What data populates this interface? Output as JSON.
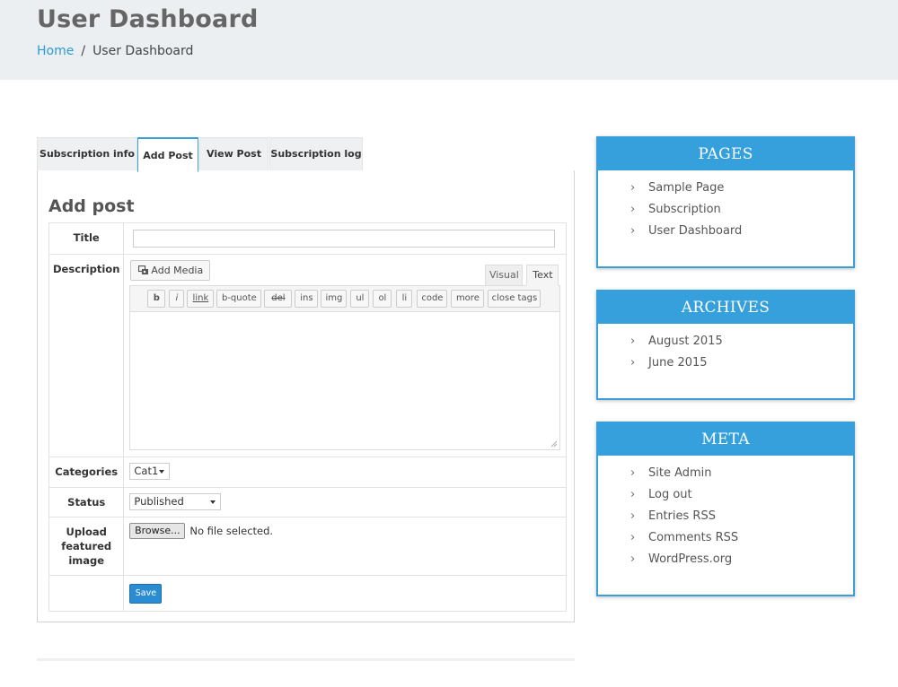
{
  "header": {
    "title": "User Dashboard",
    "breadcrumb": {
      "home": "Home",
      "separator": "/",
      "current": "User Dashboard"
    }
  },
  "tabs": [
    {
      "label": "Subscription info",
      "active": false
    },
    {
      "label": "Add Post",
      "active": true
    },
    {
      "label": "View Post",
      "active": false
    },
    {
      "label": "Subscription log",
      "active": false
    }
  ],
  "form": {
    "heading": "Add post",
    "title_label": "Title",
    "title_value": "",
    "description_label": "Description",
    "add_media": "Add Media",
    "editor_tabs": {
      "visual": "Visual",
      "text": "Text"
    },
    "quicktags": [
      "b",
      "i",
      "link",
      "b-quote",
      "del",
      "ins",
      "img",
      "ul",
      "ol",
      "li",
      "code",
      "more",
      "close tags"
    ],
    "categories_label": "Categories",
    "categories_value": "Cat1",
    "status_label": "Status",
    "status_value": "Published",
    "upload_label": "Upload featured image",
    "browse_label": "Browse...",
    "no_file": "No file selected.",
    "save_label": "Save"
  },
  "sidebar": {
    "pages": {
      "title": "PAGES",
      "items": [
        "Sample Page",
        "Subscription",
        "User Dashboard"
      ]
    },
    "archives": {
      "title": "ARCHIVES",
      "items": [
        "August 2015",
        "June 2015"
      ]
    },
    "meta": {
      "title": "META",
      "items": [
        "Site Admin",
        "Log out",
        "Entries RSS",
        "Comments RSS",
        "WordPress.org"
      ]
    }
  },
  "colors": {
    "accent": "#35a0dc",
    "link": "#2b9bd3",
    "header_bg": "#eceff2",
    "save_button": "#2a8dd3"
  },
  "icons": {
    "list_chevron": "chevron-right-icon",
    "media": "media-icon"
  }
}
